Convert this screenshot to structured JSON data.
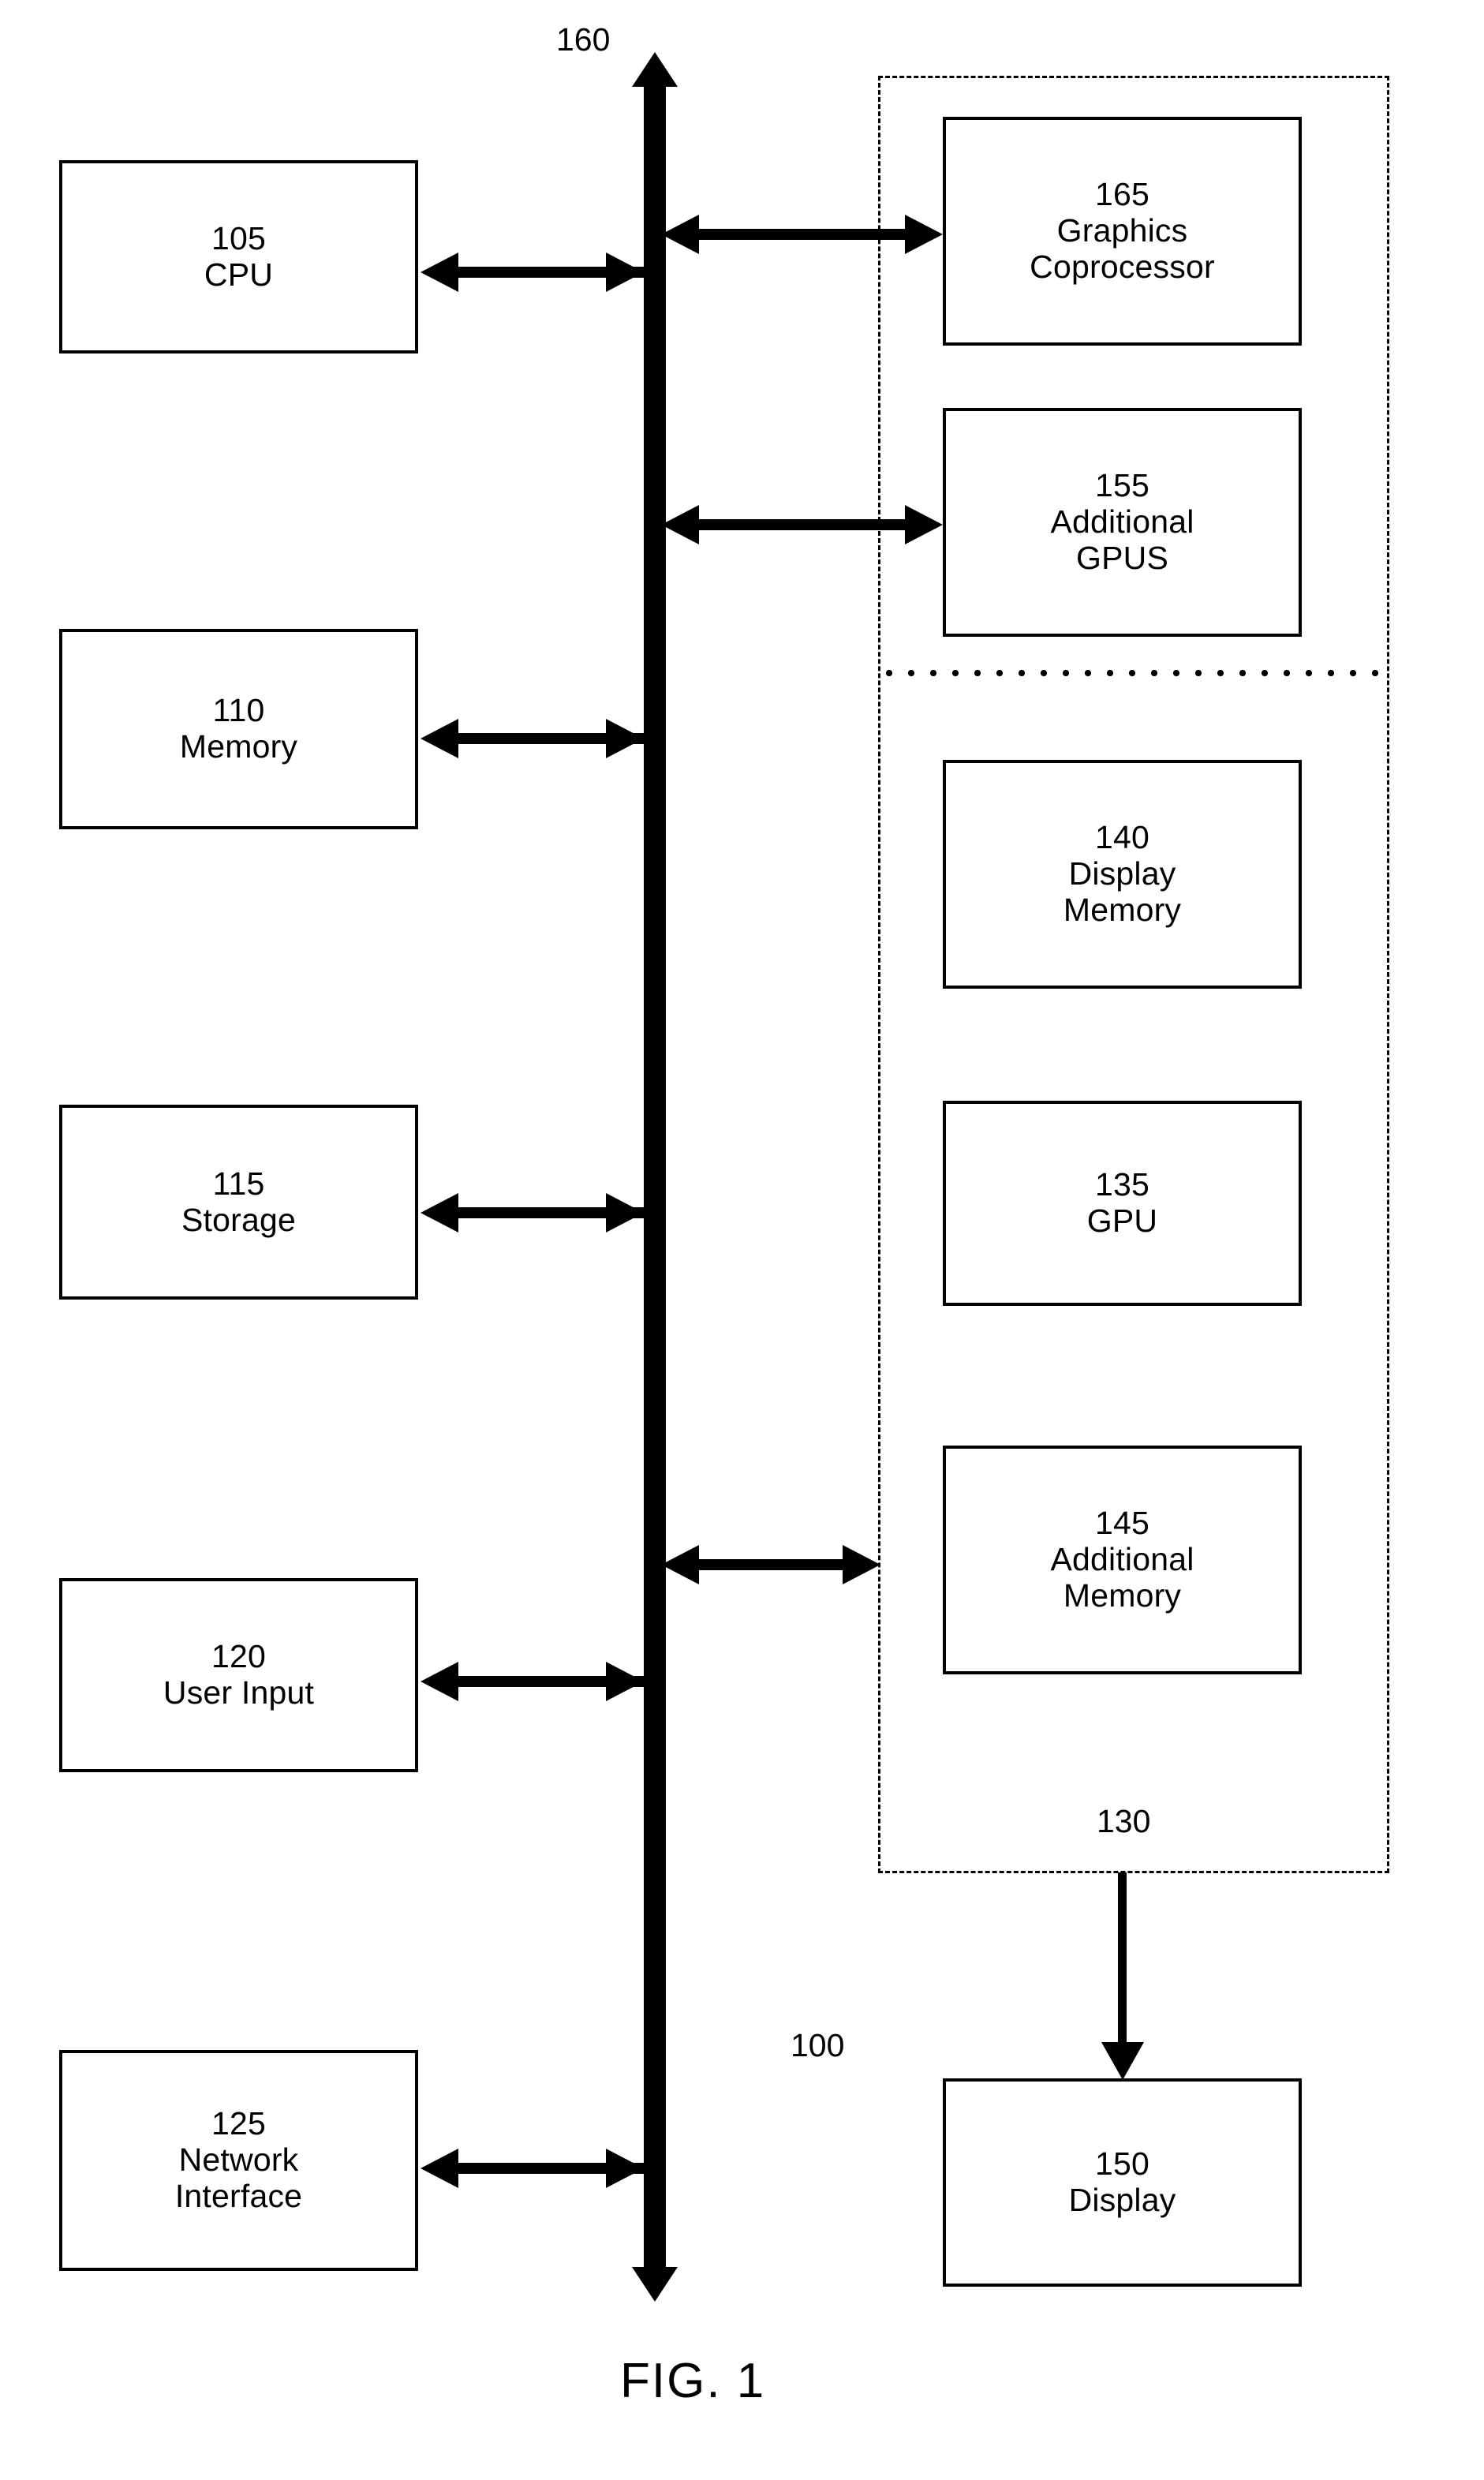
{
  "figure": {
    "caption": "FIG. 1",
    "system_ref": "100",
    "bus_ref": "160",
    "subsystem_ref": "130"
  },
  "host_components": [
    {
      "ref": "105",
      "name": "CPU"
    },
    {
      "ref": "110",
      "name": "Memory"
    },
    {
      "ref": "115",
      "name": "Storage"
    },
    {
      "ref": "120",
      "name": "User Input"
    },
    {
      "ref": "125",
      "name": "Network",
      "name2": "Interface"
    }
  ],
  "graphics_subsystem": {
    "ref": "130",
    "upper_components": [
      {
        "ref": "165",
        "name": "Graphics",
        "name2": "Coprocessor"
      },
      {
        "ref": "155",
        "name": "Additional",
        "name2": "GPUS"
      }
    ],
    "lower_components": [
      {
        "ref": "140",
        "name": "Display",
        "name2": "Memory"
      },
      {
        "ref": "135",
        "name": "GPU"
      },
      {
        "ref": "145",
        "name": "Additional",
        "name2": "Memory"
      }
    ]
  },
  "output_device": {
    "ref": "150",
    "name": "Display"
  },
  "colors": {
    "ink": "#000000",
    "paper": "#ffffff"
  }
}
